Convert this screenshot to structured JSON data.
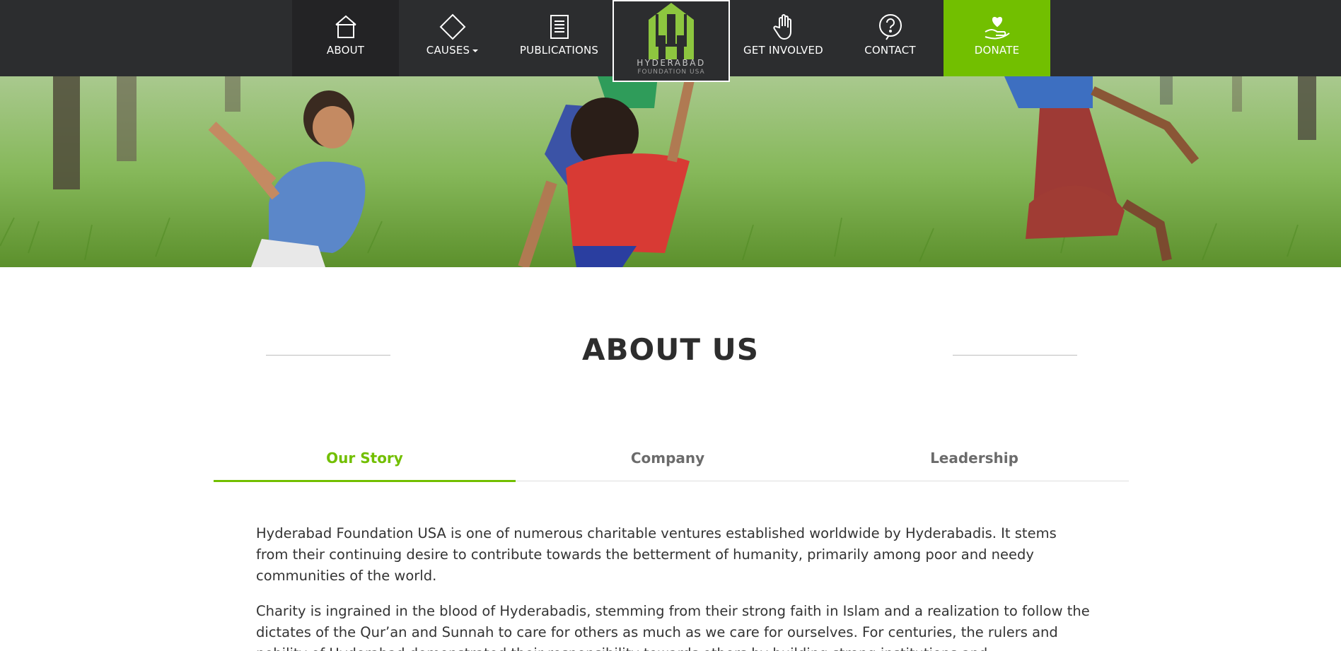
{
  "nav": {
    "items": [
      {
        "label": "ABOUT",
        "icon": "house-icon"
      },
      {
        "label": "CAUSES",
        "icon": "diamond-icon"
      },
      {
        "label": "PUBLICATIONS",
        "icon": "document-icon"
      },
      {
        "label": "GET INVOLVED",
        "icon": "hand-icon"
      },
      {
        "label": "CONTACT",
        "icon": "question-bubble-icon"
      },
      {
        "label": "DONATE",
        "icon": "heart-hand-icon"
      }
    ],
    "logo": {
      "line1": "HYDERABAD",
      "line2": "FOUNDATION USA"
    }
  },
  "hero": {
    "image": "children-playing-in-grass-photo"
  },
  "page": {
    "title": "ABOUT US"
  },
  "tabs": [
    {
      "label": "Our Story",
      "active": true
    },
    {
      "label": "Company",
      "active": false
    },
    {
      "label": "Leadership",
      "active": false
    }
  ],
  "content": {
    "paragraphs": [
      "Hyderabad Foundation USA is one of numerous charitable ventures established worldwide by Hyderabadis. It stems from their continuing desire to contribute towards the betterment of humanity, primarily among poor and needy communities of the world.",
      "Charity is ingrained in the blood of Hyderabadis, stemming from their strong faith in Islam and a realization to follow the dictates of the Qur’an and Sunnah to care for others as much as we care for ourselves. For centuries, the rulers and nobility of Hyderabad demonstrated their responsibility towards others by building strong institutions and"
    ]
  },
  "colors": {
    "nav_bg": "#2c2d2f",
    "accent_green": "#72bf00",
    "text_dark": "#2d2d2d"
  }
}
